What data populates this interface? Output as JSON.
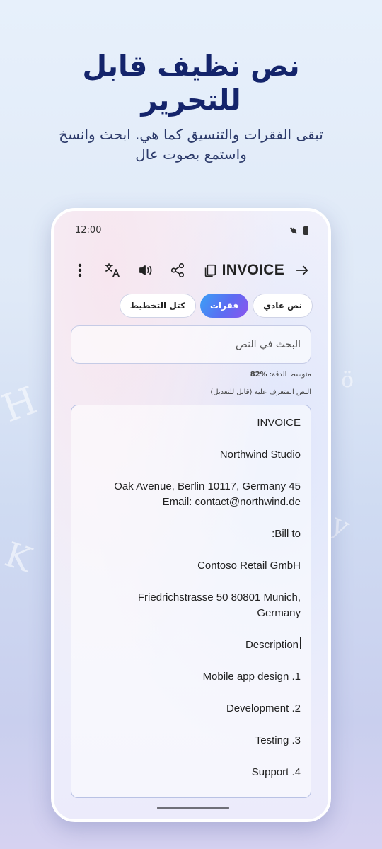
{
  "hero": {
    "title": "نص نظيف قابل للتحرير",
    "subtitle": "تبقى الفقرات والتنسيق كما هي. ابحث وانسخ واستمع بصوت عال"
  },
  "status_bar": {
    "time": "12:00"
  },
  "toolbar": {
    "title": "INVOICE",
    "icons": [
      "more-icon",
      "translate-icon",
      "speaker-icon",
      "share-icon",
      "copy-icon",
      "back-arrow-icon"
    ]
  },
  "chips": [
    {
      "label": "نص عادي",
      "active": false
    },
    {
      "label": "فقرات",
      "active": true
    },
    {
      "label": "كتل التخطيط",
      "active": false
    }
  ],
  "search": {
    "placeholder": "البحث في النص"
  },
  "accuracy": {
    "label": "متوسط الدقة:",
    "value": "82%"
  },
  "recognized_label": "النص المتعرف عليه (قابل للتعديل)",
  "recognized_text": [
    "INVOICE",
    "Northwind Studio",
    "Oak Avenue, Berlin 10117, Germany 45\nEmail: contact@northwind.de",
    ":Bill to",
    "Contoso Retail GmbH",
    "Friedrichstrasse 50 80801 Munich,\nGermany",
    "Description",
    "Mobile app design .1",
    "Development .2",
    "Testing .3",
    "Support .4"
  ],
  "colors": {
    "hero_title": "#14246b",
    "chip_active_start": "#3aa0f6",
    "chip_active_end": "#8c55ee"
  }
}
